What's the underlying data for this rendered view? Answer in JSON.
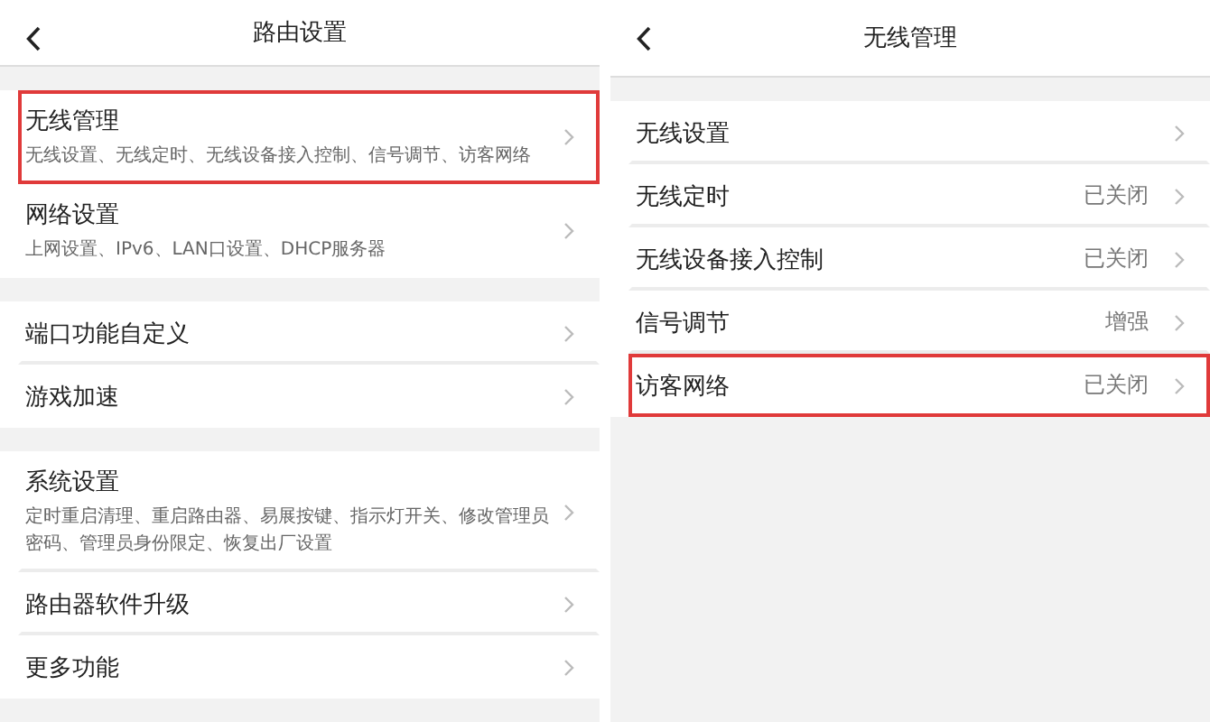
{
  "panels": [
    {
      "title": "路由设置",
      "groups": [
        [
          {
            "label": "无线管理",
            "description": "无线设置、无线定时、无线设备接入控制、信号调节、访客网络",
            "highlighted": true
          },
          {
            "label": "网络设置",
            "description": "上网设置、IPv6、LAN口设置、DHCP服务器",
            "highlighted": false
          }
        ],
        [
          {
            "label": "端口功能自定义",
            "highlighted": false
          },
          {
            "label": "游戏加速",
            "highlighted": false
          }
        ],
        [
          {
            "label": "系统设置",
            "description": "定时重启清理、重启路由器、易展按键、指示灯开关、修改管理员密码、管理员身份限定、恢复出厂设置",
            "highlighted": false
          },
          {
            "label": "路由器软件升级",
            "highlighted": false
          },
          {
            "label": "更多功能",
            "highlighted": false
          }
        ]
      ]
    },
    {
      "title": "无线管理",
      "groups": [
        [
          {
            "label": "无线设置",
            "highlighted": false
          },
          {
            "label": "无线定时",
            "value": "已关闭",
            "highlighted": false
          },
          {
            "label": "无线设备接入控制",
            "value": "已关闭",
            "highlighted": false
          },
          {
            "label": "信号调节",
            "value": "增强",
            "highlighted": false
          },
          {
            "label": "访客网络",
            "value": "已关闭",
            "highlighted": true
          }
        ]
      ]
    }
  ]
}
